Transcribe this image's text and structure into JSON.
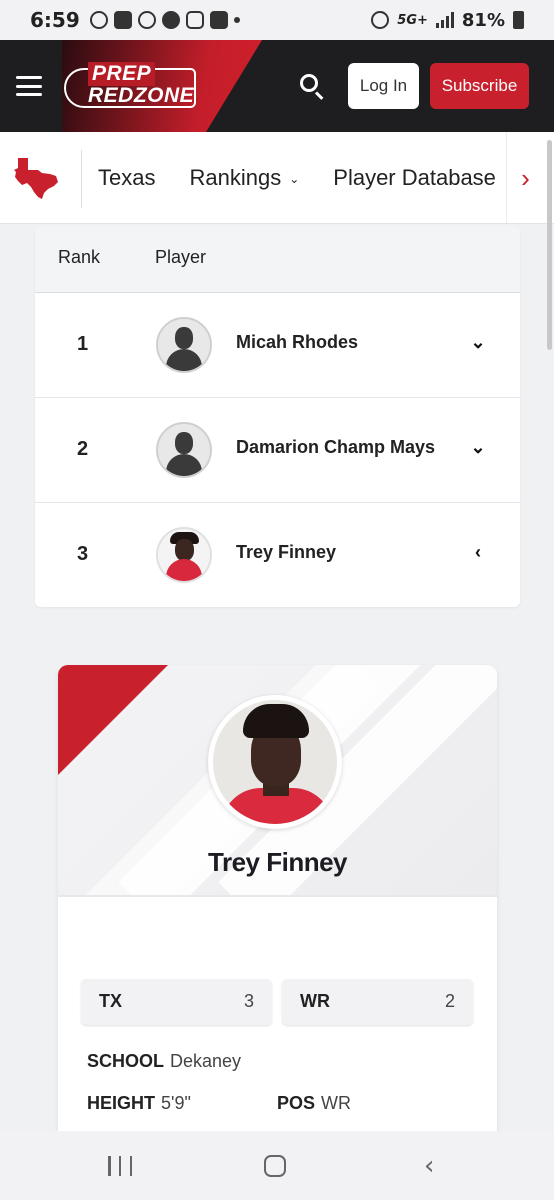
{
  "status_bar": {
    "time": "6:59",
    "network": "5G+",
    "battery": "81%"
  },
  "header": {
    "logo_top": "PREP",
    "logo_bottom": "REDZONE",
    "login_label": "Log In",
    "subscribe_label": "Subscribe",
    "colors": {
      "background": "#1e1e20",
      "accent": "#c8202c"
    }
  },
  "subnav": {
    "items": [
      {
        "label": "Texas"
      },
      {
        "label": "Rankings",
        "has_dropdown": true
      },
      {
        "label": "Player Database"
      }
    ],
    "next_icon": "chevron-right-icon"
  },
  "rankings_table": {
    "columns": [
      "Rank",
      "Player"
    ],
    "rows": [
      {
        "rank": "1",
        "name": "Micah Rhodes",
        "expanded": false
      },
      {
        "rank": "2",
        "name": "Damarion Champ Mays",
        "expanded": false
      },
      {
        "rank": "3",
        "name": "Trey Finney",
        "expanded": true
      }
    ]
  },
  "player_card": {
    "name": "Trey Finney",
    "chips": [
      {
        "label": "TX",
        "value": "3"
      },
      {
        "label": "WR",
        "value": "2"
      }
    ],
    "school_label": "SCHOOL",
    "school_value": "Dekaney",
    "height_label": "HEIGHT",
    "height_value": "5'9\"",
    "pos_label": "POS",
    "pos_value": "WR"
  }
}
